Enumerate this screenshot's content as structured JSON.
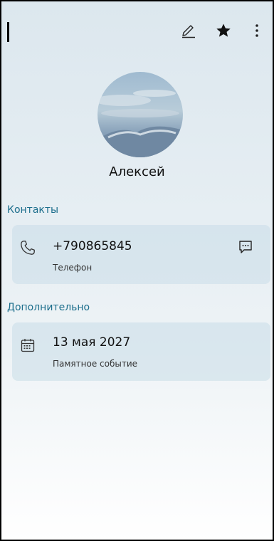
{
  "contact": {
    "name": "Алексей"
  },
  "toolbar": {
    "edit_icon": "pencil-icon",
    "favorite_icon": "star-icon",
    "more_icon": "more-vert-icon"
  },
  "sections": {
    "contacts_label": "Контакты",
    "extra_label": "Дополнительно"
  },
  "phone_entry": {
    "number": "+790865845",
    "type": "Телефон",
    "icon": "phone-icon",
    "action_icon": "message-icon"
  },
  "date_entry": {
    "date": "13 мая 2027",
    "type": "Памятное событие",
    "icon": "calendar-icon"
  },
  "colors": {
    "accent": "#1c6e8c",
    "card_bg": "#d3e2eb"
  }
}
